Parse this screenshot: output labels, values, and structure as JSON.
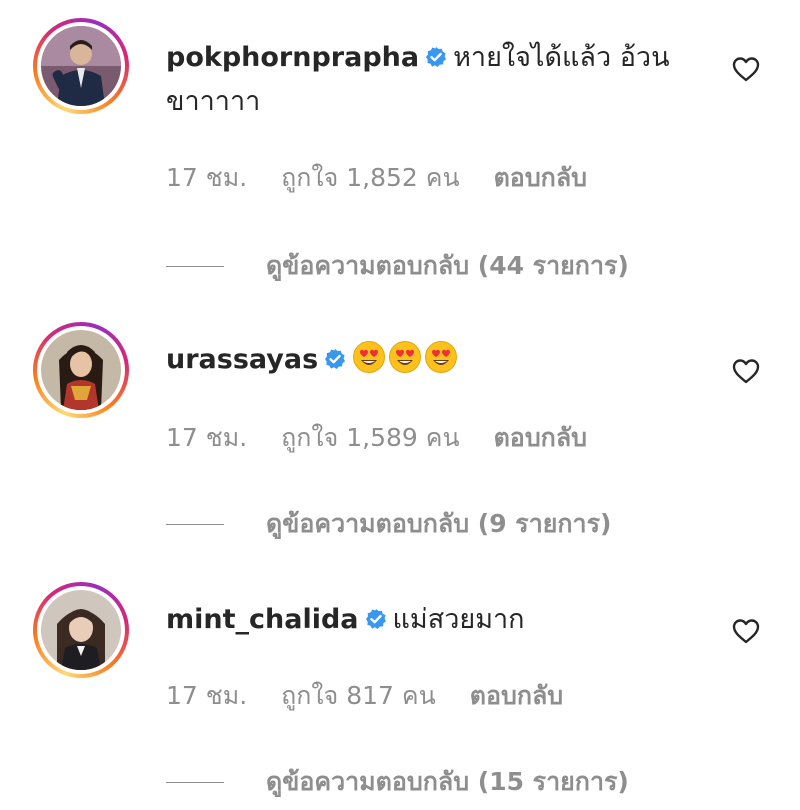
{
  "comments": [
    {
      "username": "pokphornprapha",
      "verified": true,
      "text": "หายใจได้แล้ว อ้วนขาาาาา",
      "time": "17 ชม.",
      "likes": "ถูกใจ 1,852 คน",
      "reply_label": "ตอบกลับ",
      "view_replies": "ดูข้อความตอบกลับ (44 รายการ)",
      "avatar_icon": "man-in-suit-avatar"
    },
    {
      "username": "urassayas",
      "verified": true,
      "text": "",
      "emojis": [
        "heart-eyes-emoji",
        "heart-eyes-emoji",
        "heart-eyes-emoji"
      ],
      "time": "17 ชม.",
      "likes": "ถูกใจ 1,589 คน",
      "reply_label": "ตอบกลับ",
      "view_replies": "ดูข้อความตอบกลับ (9 รายการ)",
      "avatar_icon": "woman-dark-hair-avatar"
    },
    {
      "username": "mint_chalida",
      "verified": true,
      "text": "แม่สวยมาก",
      "time": "17 ชม.",
      "likes": "ถูกใจ 817 คน",
      "reply_label": "ตอบกลับ",
      "view_replies": "ดูข้อความตอบกลับ (15 รายการ)",
      "avatar_icon": "woman-bangs-avatar"
    }
  ],
  "colors": {
    "text": "#262626",
    "muted": "#8e8e8e",
    "verified": "#3897f0",
    "ring": "#d62976"
  }
}
